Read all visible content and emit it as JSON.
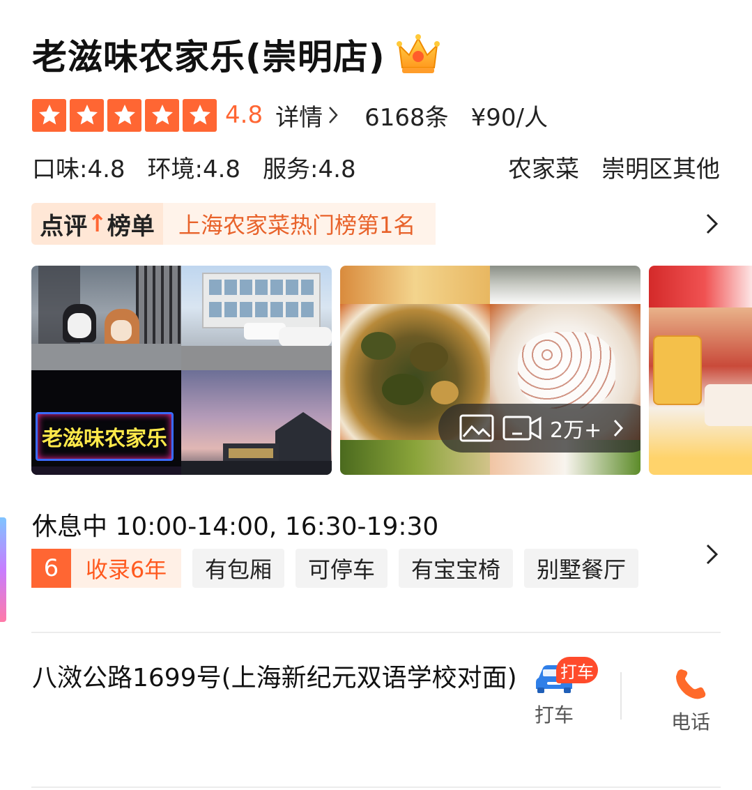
{
  "header": {
    "title": "老滋味农家乐(崇明店)",
    "crown_icon": "crown-icon"
  },
  "rating": {
    "stars": 5,
    "score": "4.8",
    "detail_label": "详情",
    "review_count": "6168条",
    "price_per_person": "¥90/人"
  },
  "subscores": {
    "taste": "口味:4.8",
    "environment": "环境:4.8",
    "service": "服务:4.8",
    "category": "农家菜",
    "area": "崇明区其他"
  },
  "ranking": {
    "tag_prefix": "点评",
    "tag_suffix": "榜单",
    "tag_arrow": "↑",
    "text": "上海农家菜热门榜第1名"
  },
  "gallery": {
    "sign_text": "老滋味农家乐",
    "media_count": "2万+",
    "photo_icon": "image-icon",
    "video_icon": "video-icon"
  },
  "hours": {
    "text": "休息中 10:00-14:00, 16:30-19:30"
  },
  "tags": {
    "years_num": "6",
    "years_text": "收录6年",
    "items": [
      "有包厢",
      "可停车",
      "有宝宝椅",
      "别墅餐厅"
    ]
  },
  "address": {
    "text": "八滧公路1699号(上海新纪元双语学校对面)",
    "taxi_badge": "打车",
    "taxi_label": "打车",
    "phone_label": "电话"
  },
  "colors": {
    "accent": "#ff6633",
    "rank_text": "#e8622a"
  }
}
